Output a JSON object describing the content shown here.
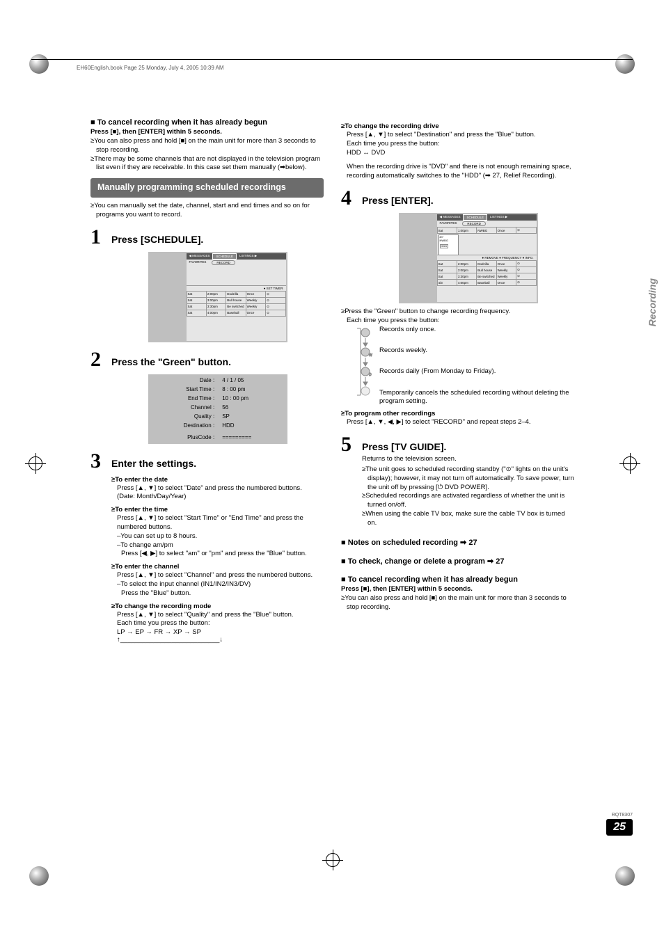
{
  "meta": {
    "print_header": "EH60English.book  Page 25  Monday, July 4, 2005  10:39 AM",
    "side_label": "Recording",
    "doc_code": "RQT8307",
    "page_number": "25"
  },
  "left": {
    "cancel_title": "■ To cancel recording when it has already begun",
    "cancel_sub": "Press [■], then [ENTER] within 5 seconds.",
    "cancel_bullets": [
      "≥You can also press and hold [■] on the main unit for more than 3 seconds to stop recording.",
      "≥There may be some channels that are not displayed in the television program list even if they are receivable. In this case set them manually (➡below)."
    ],
    "manual_title": "Manually programming scheduled recordings",
    "manual_intro": "≥You can manually set the date, channel, start and end times and so on for programs you want to record.",
    "step1_title": "Press [SCHEDULE].",
    "screen1": {
      "tabs_l": "◀ MESSAGES",
      "tabs_c": "SCHEDULE",
      "tabs_r": "LISTINGS ▶",
      "fav": "FAVORITES",
      "rec": "RECORD",
      "footer": "● SET TIMER",
      "rows": [
        [
          "Sat",
          "2:00pm",
          "Dodzilla",
          "Once",
          "⊙"
        ],
        [
          "Sat",
          "3:00pm",
          "Bull house",
          "Weekly",
          "⊙"
        ],
        [
          "Sat",
          "3:30pm",
          "Be switched",
          "Weekly",
          "⊙"
        ],
        [
          "Sat",
          "4:00pm",
          "Baseball",
          "Once",
          "⊙"
        ]
      ]
    },
    "step2_title": "Press the \"Green\" button.",
    "settings_rows": [
      [
        "Date :",
        "4 /  1 / 05"
      ],
      [
        "Start Time :",
        "8 : 00 pm"
      ],
      [
        "End Time :",
        "10 : 00 pm"
      ],
      [
        "Channel :",
        "56"
      ],
      [
        "Quality :",
        "SP"
      ],
      [
        "Destination :",
        "HDD"
      ],
      [
        "",
        ""
      ],
      [
        "PlusCode :",
        "========="
      ]
    ],
    "step3_title": "Enter the settings.",
    "s3_date_h": "≥To enter the date",
    "s3_date_b1": "Press [▲, ▼] to select \"Date\" and press the numbered buttons.",
    "s3_date_b2": "(Date: Month/Day/Year)",
    "s3_time_h": "≥To enter the time",
    "s3_time_b1": "Press [▲, ▼] to select \"Start Time\" or \"End Time\" and press the numbered buttons.",
    "s3_time_d1": "–You can set up to 8 hours.",
    "s3_time_d2": "–To change am/pm",
    "s3_time_d2b": "Press [◀, ▶] to select \"am\" or \"pm\" and press the \"Blue\" button.",
    "s3_ch_h": "≥To enter the channel",
    "s3_ch_b1": "Press [▲, ▼] to select \"Channel\" and press the numbered buttons.",
    "s3_ch_d1": "–To select the input channel (IN1/IN2/IN3/DV)",
    "s3_ch_d1b": "Press the \"Blue\" button.",
    "s3_mode_h": "≥To change the recording mode",
    "s3_mode_b1": "Press [▲, ▼] to select \"Quality\" and press the \"Blue\" button.",
    "s3_mode_b2": "Each time you press the button:",
    "s3_mode_seq": "LP  →  EP  →  FR  →  XP  →  SP",
    "s3_mode_seq2": "↑___________________________↓"
  },
  "right": {
    "drive_h": "≥To change the recording drive",
    "drive_b1": "Press [▲, ▼] to select \"Destination\" and press the \"Blue\" button.",
    "drive_b2": "Each time you press the button:",
    "drive_b3": "HDD ↔ DVD",
    "drive_b4": "When the recording drive is \"DVD\" and there is not enough remaining space, recording automatically switches to the \"HDD\" (➡ 27, Relief Recording).",
    "step4_title": "Press [ENTER].",
    "screen2": {
      "tabs_l": "◀ MESSAGES",
      "tabs_c": "SCHEDULE",
      "tabs_r": "LISTINGS ▶",
      "fav": "FAVORITES",
      "rec": "RECORD",
      "overlay_line1": "8/7",
      "overlay_line2": "NWBG",
      "overlay_dest": "HDD",
      "footer": "● REMOVE    ● FREQUENCY  ● INFO.",
      "rows": [
        [
          "Sat",
          "1:00pm",
          "NWBG",
          "Once",
          "⊙"
        ],
        [
          "",
          "",
          "",
          "",
          ""
        ],
        [
          "",
          "",
          "",
          "",
          ""
        ],
        [
          "Sat",
          "2:00pm",
          "Dodzilla",
          "Once",
          "⊙"
        ],
        [
          "Sat",
          "3:00pm",
          "Bull house",
          "Weekly",
          "⊙"
        ],
        [
          "Sat",
          "3:30pm",
          "Be switched",
          "Weekly",
          "⊙"
        ],
        [
          "4/3",
          "4:00pm",
          "Baseball",
          "Once",
          "⊙"
        ]
      ]
    },
    "freq_intro": "≥Press the \"Green\" button to change recording frequency.",
    "freq_sub": "Each time you press the button:",
    "freq_items": [
      "Records only once.",
      "Records weekly.",
      "Records daily (From Monday to Friday).",
      "Temporarily cancels the scheduled recording without deleting the program setting."
    ],
    "prog_other_h": "≥To program other recordings",
    "prog_other_b": "Press [▲, ▼, ◀, ▶] to select \"RECORD\" and repeat steps 2–4.",
    "step5_title": "Press [TV GUIDE].",
    "step5_sub": "Returns to the television screen.",
    "step5_bullets": [
      "≥The unit goes to scheduled recording standby (\"⊙\" lights on the unit's display); however, it may not turn off automatically. To save power, turn the unit off by pressing [⏻ DVD POWER].",
      "≥Scheduled recordings are activated regardless of whether the unit is turned on/off.",
      "≥When using the cable TV box, make sure the cable TV box is turned on."
    ],
    "notes_ref1": "■ Notes on scheduled recording ➡ 27",
    "notes_ref2": "■ To check, change or delete a program ➡ 27",
    "cancel2_title": "■ To cancel recording when it has already begun",
    "cancel2_sub": "Press [■], then [ENTER] within 5 seconds.",
    "cancel2_bullet": "≥You can also press and hold [■] on the main unit for more than 3 seconds to stop recording."
  }
}
